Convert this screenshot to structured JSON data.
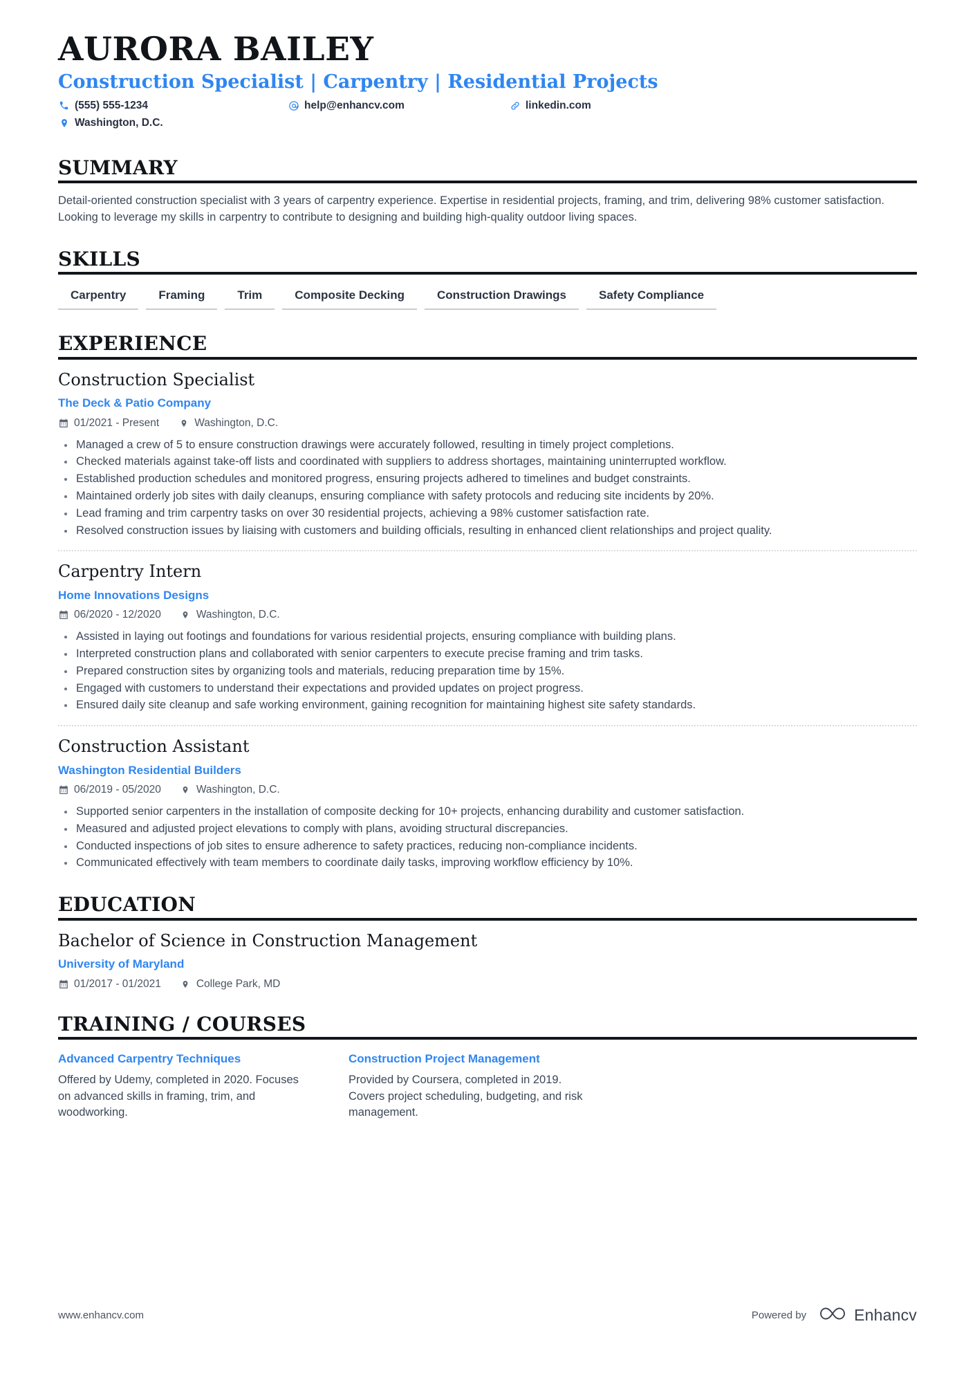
{
  "header": {
    "name": "AURORA BAILEY",
    "headline": "Construction Specialist | Carpentry | Residential Projects",
    "contacts": [
      {
        "icon": "phone-icon",
        "text": "(555) 555-1234"
      },
      {
        "icon": "email-icon",
        "text": "help@enhancv.com"
      },
      {
        "icon": "link-icon",
        "text": "linkedin.com"
      },
      {
        "icon": "location-icon",
        "text": "Washington, D.C."
      }
    ]
  },
  "summary": {
    "title": "SUMMARY",
    "text": "Detail-oriented construction specialist with 3 years of carpentry experience. Expertise in residential projects, framing, and trim, delivering 98% customer satisfaction. Looking to leverage my skills in carpentry to contribute to designing and building high-quality outdoor living spaces."
  },
  "skills": {
    "title": "SKILLS",
    "items": [
      "Carpentry",
      "Framing",
      "Trim",
      "Composite Decking",
      "Construction Drawings",
      "Safety Compliance"
    ]
  },
  "experience": {
    "title": "EXPERIENCE",
    "entries": [
      {
        "job_title": "Construction Specialist",
        "company": "The Deck & Patio Company",
        "dates": "01/2021 - Present",
        "location": "Washington, D.C.",
        "bullets": [
          "Managed a crew of 5 to ensure construction drawings were accurately followed, resulting in timely project completions.",
          "Checked materials against take-off lists and coordinated with suppliers to address shortages, maintaining uninterrupted workflow.",
          "Established production schedules and monitored progress, ensuring projects adhered to timelines and budget constraints.",
          "Maintained orderly job sites with daily cleanups, ensuring compliance with safety protocols and reducing site incidents by 20%.",
          "Lead framing and trim carpentry tasks on over 30 residential projects, achieving a 98% customer satisfaction rate.",
          "Resolved construction issues by liaising with customers and building officials, resulting in enhanced client relationships and project quality."
        ]
      },
      {
        "job_title": "Carpentry Intern",
        "company": "Home Innovations Designs",
        "dates": "06/2020 - 12/2020",
        "location": "Washington, D.C.",
        "bullets": [
          "Assisted in laying out footings and foundations for various residential projects, ensuring compliance with building plans.",
          "Interpreted construction plans and collaborated with senior carpenters to execute precise framing and trim tasks.",
          "Prepared construction sites by organizing tools and materials, reducing preparation time by 15%.",
          "Engaged with customers to understand their expectations and provided updates on project progress.",
          "Ensured daily site cleanup and safe working environment, gaining recognition for maintaining highest site safety standards."
        ]
      },
      {
        "job_title": "Construction Assistant",
        "company": "Washington Residential Builders",
        "dates": "06/2019 - 05/2020",
        "location": "Washington, D.C.",
        "bullets": [
          "Supported senior carpenters in the installation of composite decking for 10+ projects, enhancing durability and customer satisfaction.",
          "Measured and adjusted project elevations to comply with plans, avoiding structural discrepancies.",
          "Conducted inspections of job sites to ensure adherence to safety practices, reducing non-compliance incidents.",
          "Communicated effectively with team members to coordinate daily tasks, improving workflow efficiency by 10%."
        ]
      }
    ]
  },
  "education": {
    "title": "EDUCATION",
    "entries": [
      {
        "degree": "Bachelor of Science in Construction Management",
        "school": "University of Maryland",
        "dates": "01/2017 - 01/2021",
        "location": "College Park, MD"
      }
    ]
  },
  "training": {
    "title": "TRAINING / COURSES",
    "courses": [
      {
        "title": "Advanced Carpentry Techniques",
        "description": "Offered by Udemy, completed in 2020. Focuses on advanced skills in framing, trim, and woodworking."
      },
      {
        "title": "Construction Project Management",
        "description": "Provided by Coursera, completed in 2019. Covers project scheduling, budgeting, and risk management."
      }
    ]
  },
  "footer": {
    "url": "www.enhancv.com",
    "powered_by": "Powered by",
    "brand": "Enhancv"
  },
  "colors": {
    "accent_blue": "#2f86f0",
    "heading_black": "#111418",
    "body_text": "#3c4858",
    "rule": "#12161b",
    "skill_underline": "#c9ccd1"
  }
}
